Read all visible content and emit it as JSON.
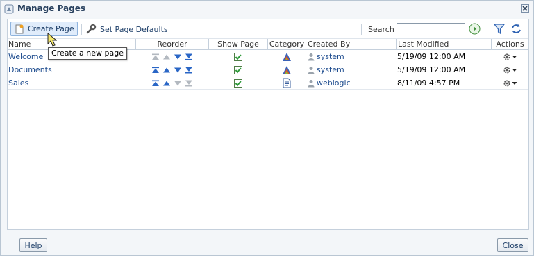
{
  "dialog": {
    "title": "Manage Pages",
    "help_label": "Help",
    "close_label": "Close"
  },
  "toolbar": {
    "create_label": "Create Page",
    "defaults_label": "Set Page Defaults",
    "search_label": "Search",
    "search_value": "",
    "search_placeholder": ""
  },
  "tooltip": "Create a new page",
  "columns": {
    "name": "Name",
    "reorder": "Reorder",
    "show_page": "Show Page",
    "category": "Category",
    "created_by": "Created By",
    "last_modified": "Last Modified",
    "actions": "Actions"
  },
  "rows": [
    {
      "name": "Welcome",
      "created_by": "system",
      "last_modified": "5/19/09 12:00 AM",
      "show_page": true,
      "can_move_up": false,
      "can_move_down": true,
      "category_icon": "system-page-icon"
    },
    {
      "name": "Documents",
      "created_by": "system",
      "last_modified": "5/19/09 12:00 AM",
      "show_page": true,
      "can_move_up": true,
      "can_move_down": true,
      "category_icon": "system-page-icon"
    },
    {
      "name": "Sales",
      "created_by": "weblogic",
      "last_modified": "8/11/09 4:57 PM",
      "show_page": true,
      "can_move_up": true,
      "can_move_down": false,
      "category_icon": "document-page-icon"
    }
  ],
  "colors": {
    "accent": "#1f4d8f",
    "arrow_enabled": "#2a66c6",
    "arrow_disabled": "#b3b9c0",
    "check": "#2f9a3a"
  }
}
